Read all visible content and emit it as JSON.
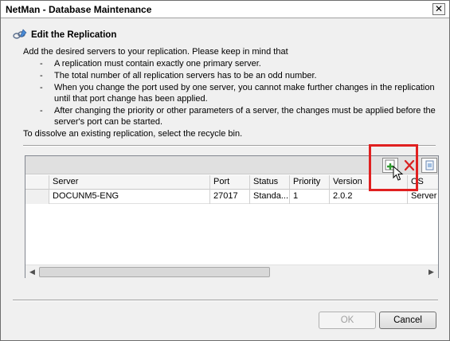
{
  "window": {
    "title": "NetMan - Database Maintenance",
    "close_label": "✕"
  },
  "header": {
    "title": "Edit the Replication",
    "icon": "link-edit-icon"
  },
  "description": {
    "intro": "Add the desired servers to your replication. Please keep in mind that",
    "bullets": [
      "A replication must contain exactly one primary server.",
      "The total number of all replication servers has to be an odd number.",
      "When you change the port used by one server, you cannot make further changes in the replication until that port change has been applied.",
      "After changing the priority or other parameters of a server, the changes must be applied before the server's port can be started."
    ],
    "dissolve": "To dissolve an existing replication, select the recycle bin."
  },
  "grid": {
    "toolbar": {
      "add_icon": "add-server-icon",
      "delete_icon": "delete-x-icon",
      "copy_icon": "copy-icon"
    },
    "columns": [
      "Server",
      "Port",
      "Status",
      "Priority",
      "Version",
      "OS"
    ],
    "rows": [
      {
        "server": "DOCUNM5-ENG",
        "port": "27017",
        "status": "Standa...",
        "priority": "1",
        "version": "2.0.2",
        "os": "Server"
      }
    ]
  },
  "buttons": {
    "ok": "OK",
    "cancel": "Cancel"
  }
}
